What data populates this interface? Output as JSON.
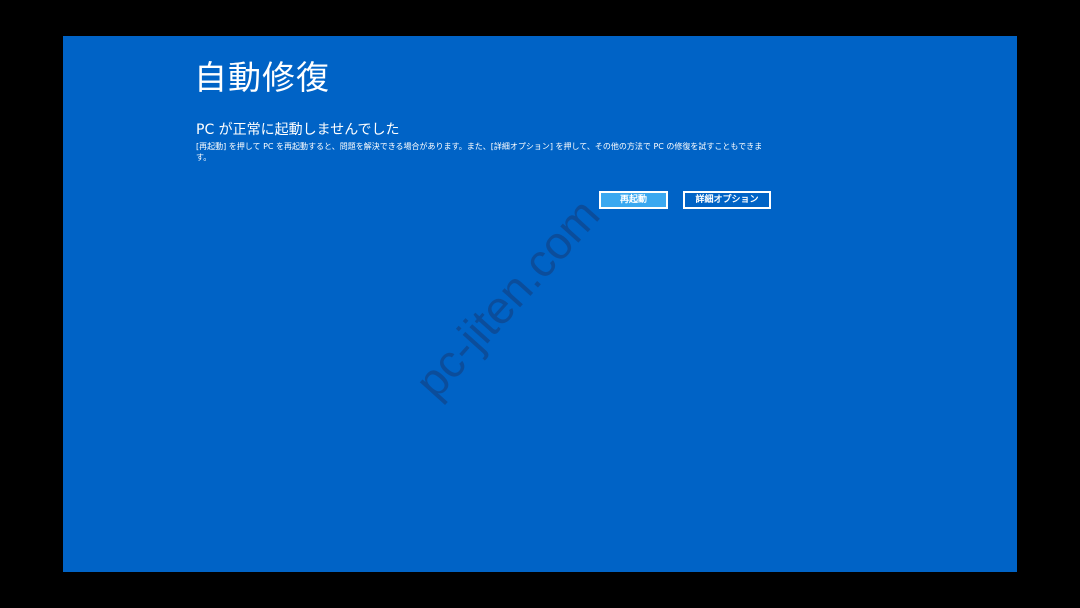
{
  "screen": {
    "title": "自動修復",
    "heading": "PC が正常に起動しませんでした",
    "description": "[再起動] を押して PC を再起動すると、問題を解決できる場合があります。また、[詳細オプション] を押して、その他の方法で PC の修復を試すこともできます。",
    "buttons": {
      "restart_label": "再起動",
      "advanced_label": "詳細オプション"
    },
    "watermark": "pc-jiten.com"
  },
  "colors": {
    "screen_background": "#0063c6",
    "outer_background": "#000000",
    "restart_button_fill": "#3aa8f0",
    "text": "#ffffff"
  }
}
